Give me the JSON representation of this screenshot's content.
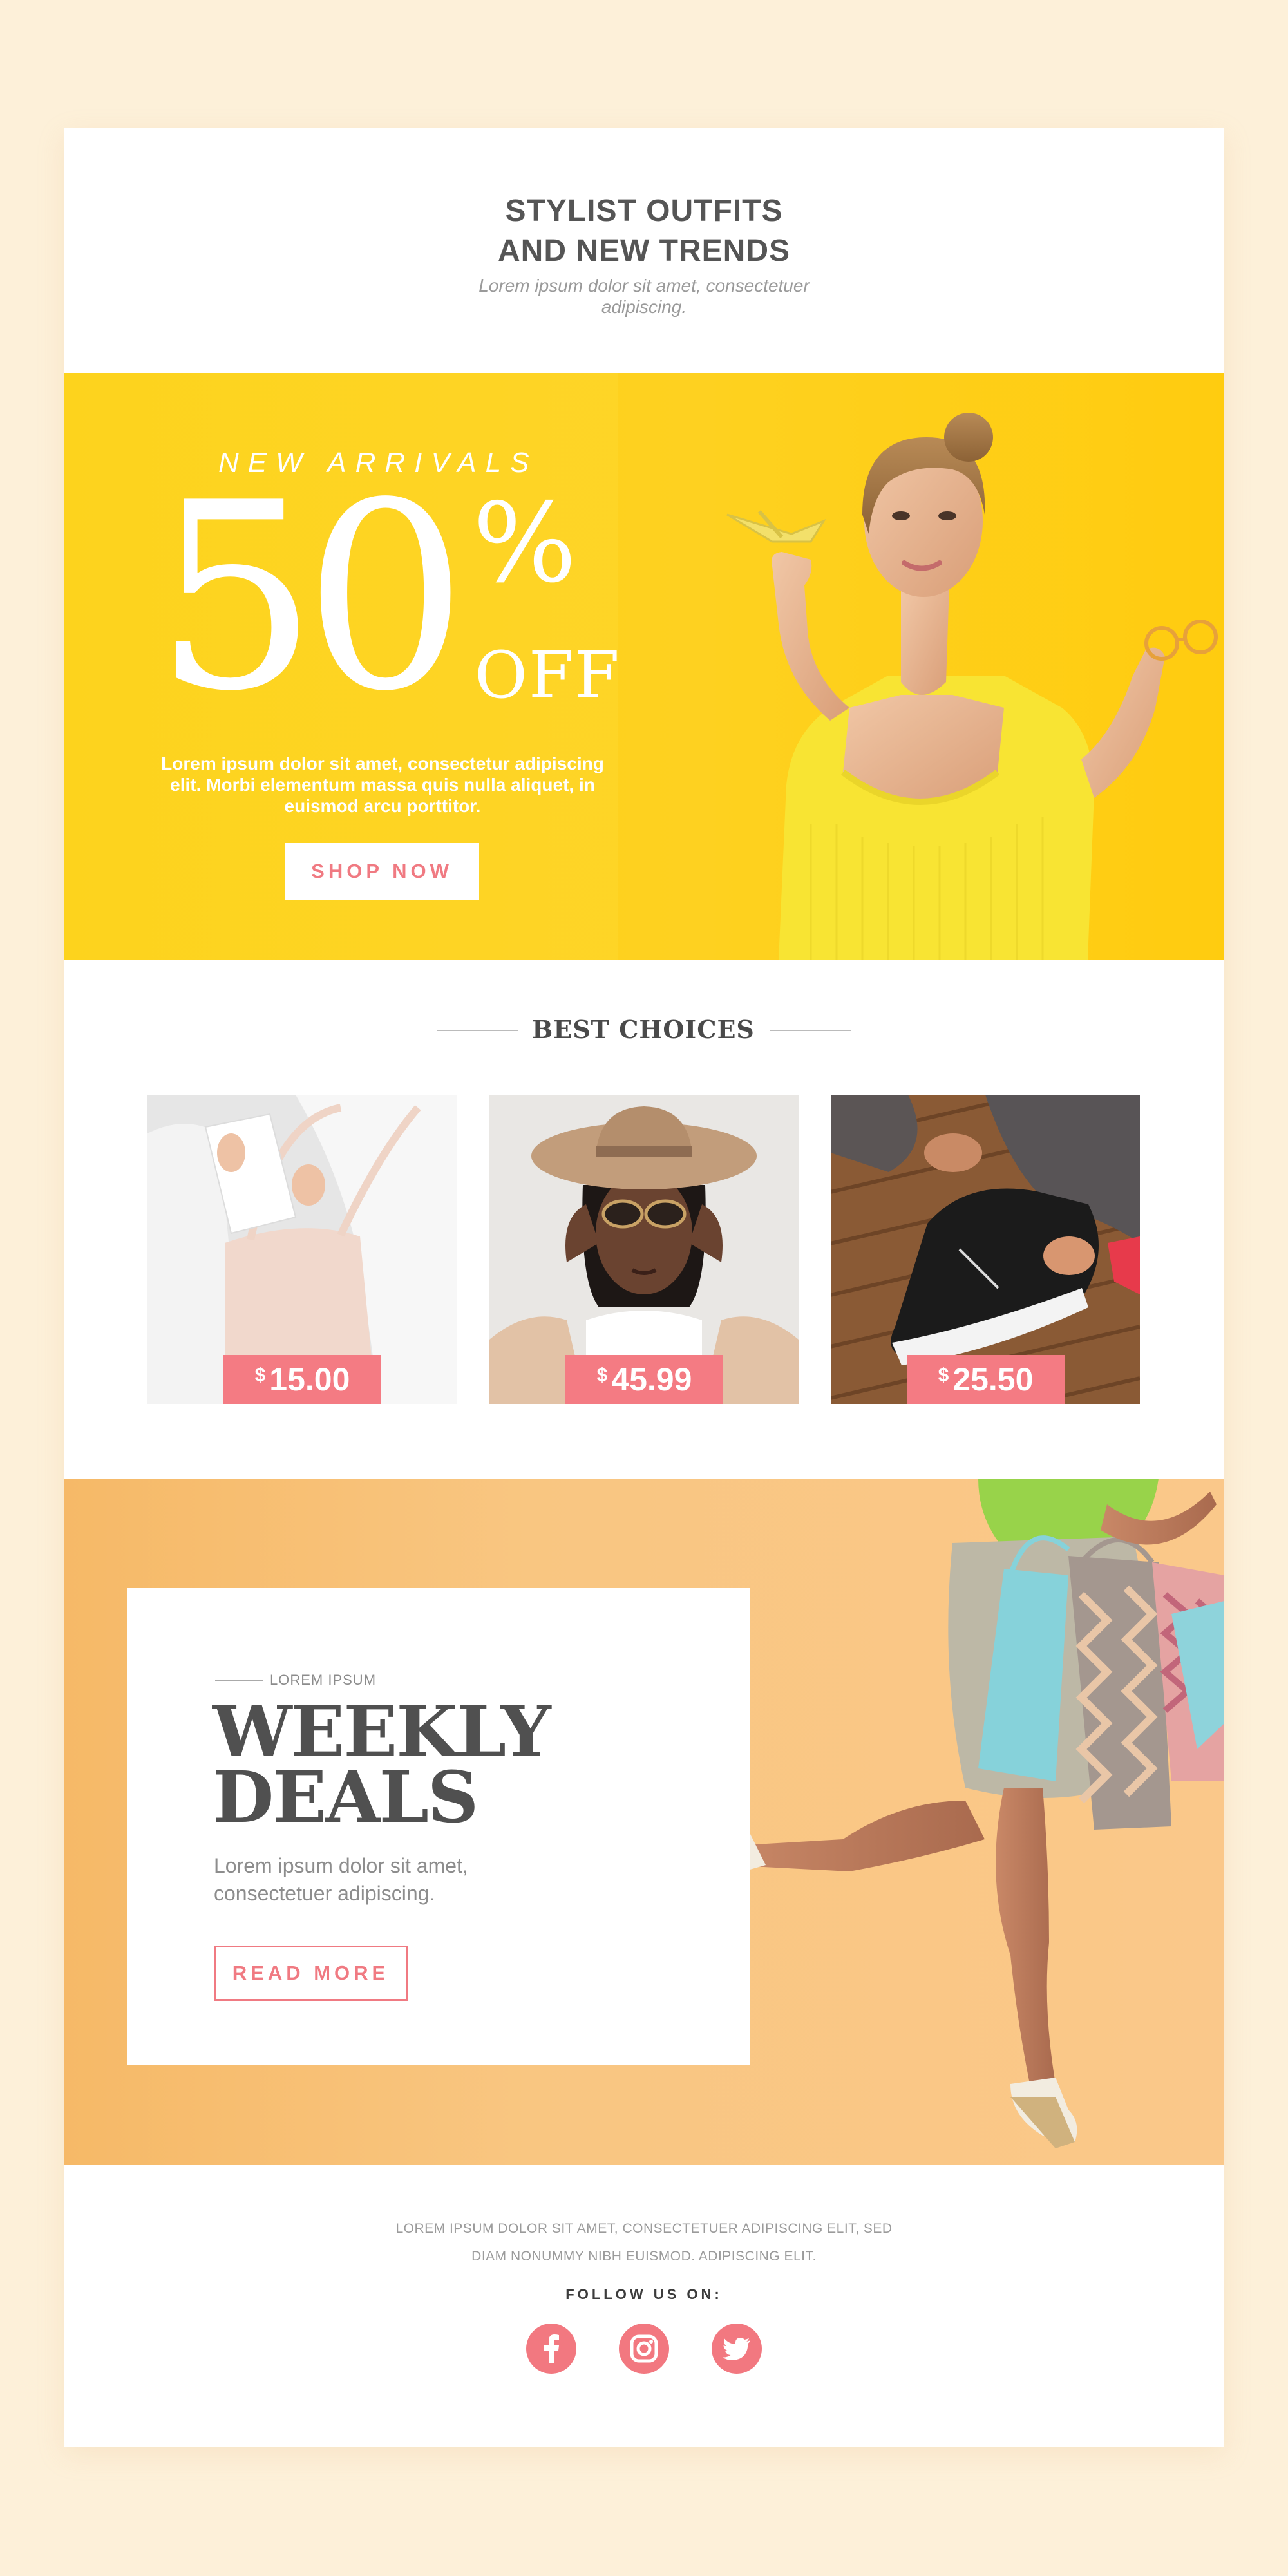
{
  "header": {
    "title_line1": "STYLIST OUTFITS",
    "title_line2": "AND NEW TRENDS",
    "subtitle_line1": "Lorem ipsum dolor sit amet, consectetuer",
    "subtitle_line2": "adipiscing."
  },
  "hero": {
    "kicker": "NEW ARRIVALS",
    "discount_number": "50",
    "percent_sign": "%",
    "off_label": "OFF",
    "description_line1": "Lorem ipsum dolor sit amet, consectetur adipiscing",
    "description_line2": "elit. Morbi elementum massa quis nulla aliquet, in",
    "description_line3": "euismod arcu porttitor.",
    "button_label": "SHOP NOW",
    "background_color": "#fdd31d"
  },
  "best_choices": {
    "title": "BEST CHOICES",
    "products": [
      {
        "currency": "$",
        "price": "15.00"
      },
      {
        "currency": "$",
        "price": "45.99"
      },
      {
        "currency": "$",
        "price": "25.50"
      }
    ]
  },
  "weekly": {
    "kicker": "LOREM IPSUM",
    "title_line1": "WEEKLY",
    "title_line2": "DEALS",
    "description_line1": "Lorem ipsum dolor sit amet,",
    "description_line2": "consectetuer adipiscing.",
    "button_label": "READ MORE",
    "background_color": "#f8c27b"
  },
  "footer": {
    "text_line1": "LOREM IPSUM DOLOR SIT AMET, CONSECTETUER ADIPISCING ELIT, SED",
    "text_line2": "DIAM NONUMMY NIBH EUISMOD. ADIPISCING ELIT.",
    "follow_label": "FOLLOW US ON:",
    "social_icons": [
      "facebook-icon",
      "instagram-icon",
      "twitter-icon"
    ]
  },
  "colors": {
    "page_background": "#fdf0d9",
    "accent_pink": "#f47b83",
    "text_dark": "#555555",
    "text_muted": "#9a9a9a"
  }
}
